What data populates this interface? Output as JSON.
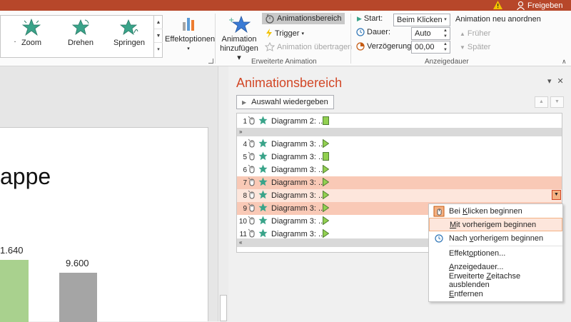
{
  "topbar": {
    "share_label": "Freigeben"
  },
  "ribbon": {
    "gallery": [
      {
        "label": "Zoom",
        "icon": "star-zoom-icon"
      },
      {
        "label": "Drehen",
        "icon": "star-spin-icon"
      },
      {
        "label": "Springen",
        "icon": "star-bounce-icon"
      }
    ],
    "effect_options_label": "Effektoptionen",
    "add_animation_label_1": "Animation",
    "add_animation_label_2": "hinzufügen",
    "animation_pane_label": "Animationsbereich",
    "trigger_label": "Trigger",
    "animation_painter_label": "Animation übertragen",
    "advanced_group_label": "Erweiterte Animation",
    "start_label": "Start:",
    "start_value": "Beim Klicken",
    "duration_label": "Dauer:",
    "duration_value": "Auto",
    "delay_label": "Verzögerung:",
    "delay_value": "00,00",
    "reorder_title": "Animation neu anordnen",
    "earlier_label": "Früher",
    "later_label": "Später",
    "timing_group_label": "Anzeigedauer"
  },
  "slide": {
    "title_fragment": "appe",
    "bar1_label": "1.640",
    "bar2_label": "9.600",
    "colors": {
      "bar1": "#a9d18e",
      "bar2": "#a5a5a5"
    }
  },
  "pane": {
    "title": "Animationsbereich",
    "play_label": "Auswahl wiedergeben",
    "items": [
      {
        "num": "1",
        "label": "Diagramm 2: ...",
        "timeline": "block"
      },
      {
        "num": "4",
        "label": "Diagramm 3: ...",
        "timeline": "tri"
      },
      {
        "num": "5",
        "label": "Diagramm 3: ...",
        "timeline": "block"
      },
      {
        "num": "6",
        "label": "Diagramm 3: ...",
        "timeline": "tri"
      },
      {
        "num": "7",
        "label": "Diagramm 3: ...",
        "timeline": "tri"
      },
      {
        "num": "8",
        "label": "Diagramm 3: ...",
        "timeline": "tri"
      },
      {
        "num": "9",
        "label": "Diagramm 3: ...",
        "timeline": "tri"
      },
      {
        "num": "10",
        "label": "Diagramm 3: ...",
        "timeline": "tri"
      },
      {
        "num": "11",
        "label": "Diagramm 3: ...",
        "timeline": "tri"
      }
    ]
  },
  "context_menu": {
    "on_click": {
      "pre": "Bei ",
      "u": "K",
      "post": "licken beginnen"
    },
    "with_previous": {
      "pre": "",
      "u": "M",
      "post": "it vorherigem beginnen"
    },
    "after_previous": {
      "pre": "Nach ",
      "u": "v",
      "post": "orherigem beginnen"
    },
    "effect_options": {
      "pre": "Effekt",
      "u": "o",
      "post": "ptionen..."
    },
    "timing": {
      "pre": "",
      "u": "A",
      "post": "nzeigedauer..."
    },
    "hide_timeline": {
      "pre": "Erweiterte ",
      "u": "Z",
      "post": "eitachse ausblenden"
    },
    "remove": {
      "pre": "",
      "u": "E",
      "post": "ntfernen"
    }
  }
}
